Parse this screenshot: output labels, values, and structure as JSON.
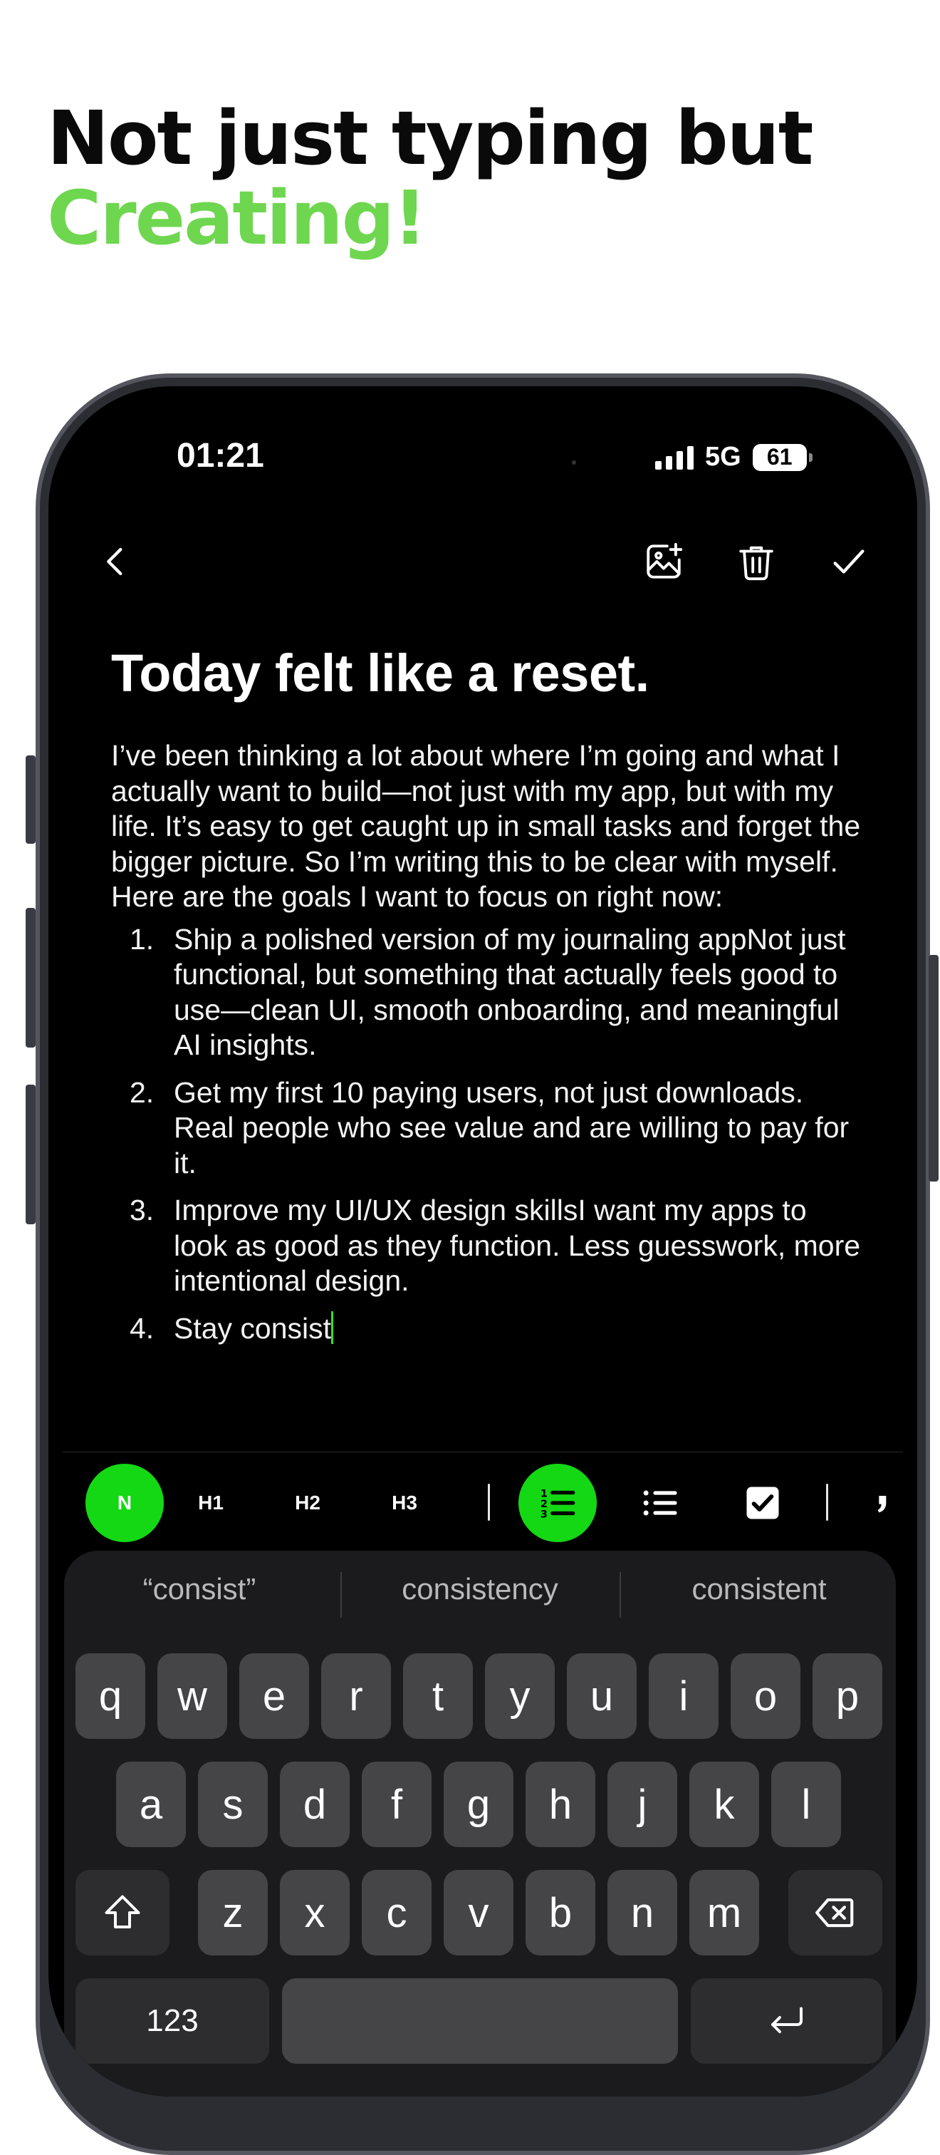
{
  "headline": {
    "line1": "Not just typing but",
    "line2": "Creating!"
  },
  "colors": {
    "accent": "#6fd650",
    "active_format": "#14d814",
    "caret": "#2fe02f"
  },
  "status_bar": {
    "time": "01:21",
    "network": "5G",
    "battery": "61"
  },
  "nav": {
    "back_icon": "chevron-left-icon",
    "add_image_icon": "image-plus-icon",
    "delete_icon": "trash-icon",
    "done_icon": "checkmark-icon"
  },
  "note": {
    "title": "Today felt like a reset.",
    "intro": "I’ve been thinking a lot about where I’m going and what I actually want to build—not just with my app, but with my life. It’s easy to get caught up in small tasks and forget the bigger picture. So I’m writing this to be clear with myself.",
    "lead": "Here are the goals I want to focus on right now:",
    "items": [
      {
        "num": "1.",
        "text": "Ship a polished version of my journaling appNot just functional, but something that actually feels good to use—clean UI, smooth onboarding, and meaningful AI insights."
      },
      {
        "num": "2.",
        "text": "Get my first 10 paying users, not just downloads. Real people who see value and are willing to pay for it."
      },
      {
        "num": "3.",
        "text": "Improve my UI/UX design skillsI want my apps to look as good as they function. Less guesswork, more intentional design."
      },
      {
        "num": "4.",
        "text": "Stay consist"
      }
    ]
  },
  "format_toolbar": {
    "normal": "N",
    "h1": "H1",
    "h2": "H2",
    "h3": "H3",
    "numbered_icon": "numbered-list-icon",
    "bullet_icon": "bullet-list-icon",
    "checkbox_icon": "checkbox-icon",
    "quote_icon": "quote-icon",
    "active": "numbered"
  },
  "keyboard": {
    "suggestions": [
      "“consist”",
      "consistency",
      "consistent"
    ],
    "row1": [
      "q",
      "w",
      "e",
      "r",
      "t",
      "y",
      "u",
      "i",
      "o",
      "p"
    ],
    "row2": [
      "a",
      "s",
      "d",
      "f",
      "g",
      "h",
      "j",
      "k",
      "l"
    ],
    "row3": [
      "z",
      "x",
      "c",
      "v",
      "b",
      "n",
      "m"
    ],
    "numbers_key": "123",
    "shift_icon": "shift-icon",
    "delete_icon": "backspace-icon",
    "return_icon": "return-icon"
  }
}
